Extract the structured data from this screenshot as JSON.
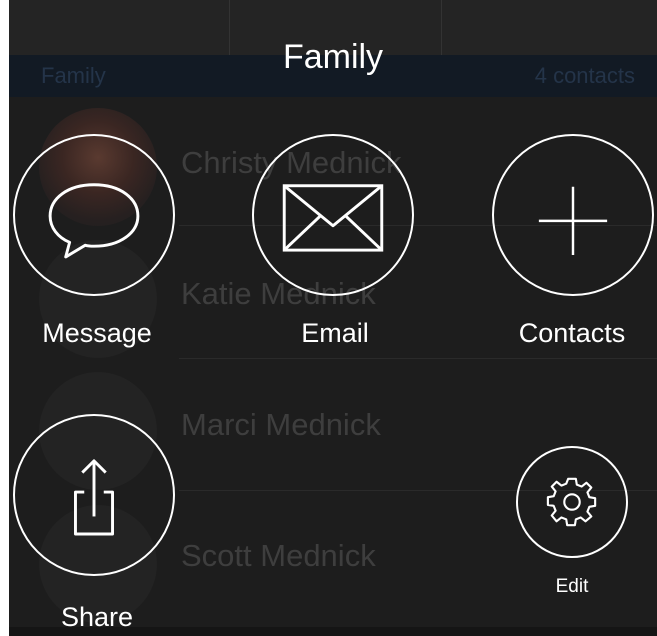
{
  "group": {
    "name": "Family",
    "count_label": "4 contacts"
  },
  "contacts": [
    {
      "name": "Christy Mednick"
    },
    {
      "name": "Katie Mednick"
    },
    {
      "name": "Marci Mednick"
    },
    {
      "name": "Scott Mednick"
    }
  ],
  "menu": {
    "title": "Family",
    "actions": {
      "message": {
        "label": "Message",
        "icon": "speech-bubble-icon"
      },
      "email": {
        "label": "Email",
        "icon": "envelope-icon"
      },
      "contacts": {
        "label": "Contacts",
        "icon": "plus-icon"
      },
      "share": {
        "label": "Share",
        "icon": "share-icon"
      },
      "edit": {
        "label": "Edit",
        "icon": "gear-icon"
      }
    }
  },
  "colors": {
    "overlay_bg": "#1d1d1d",
    "foreground": "#ffffff",
    "dimmed_text": "#3e3e3e",
    "header_bg": "#121a24"
  }
}
